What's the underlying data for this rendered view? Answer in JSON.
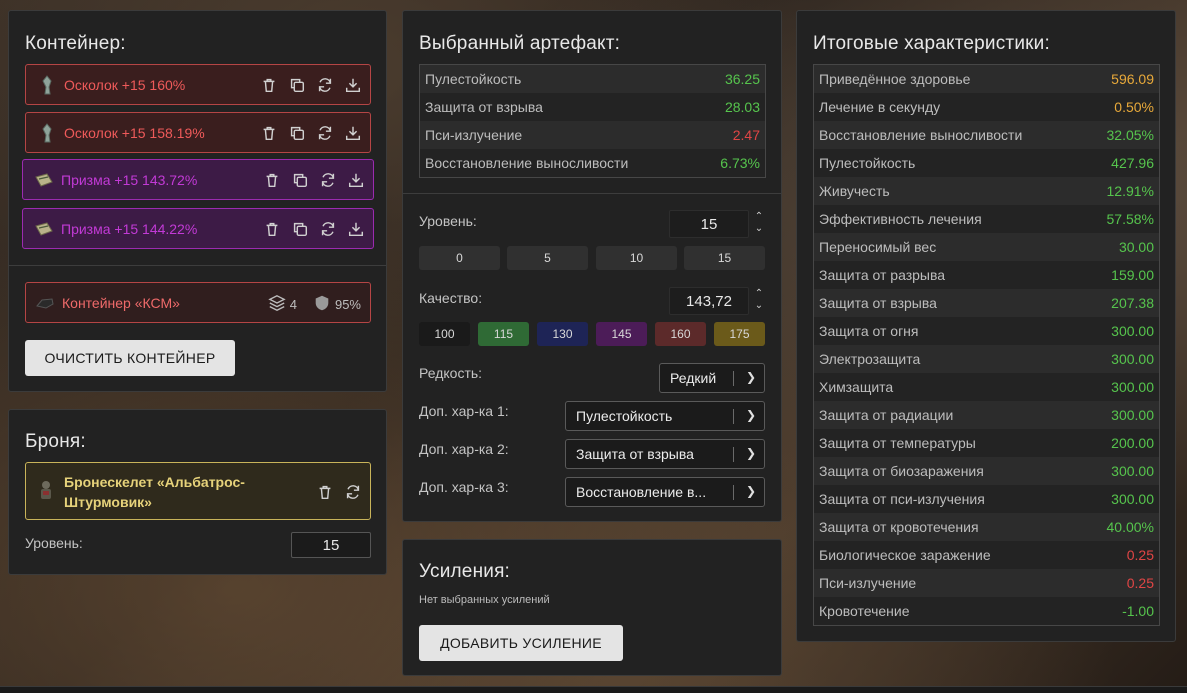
{
  "container": {
    "title": "Контейнер:",
    "artifacts": [
      {
        "name": "Осколок +15 160%",
        "rarity": "red",
        "icon": "shard-icon"
      },
      {
        "name": "Осколок +15 158.19%",
        "rarity": "red",
        "icon": "shard-icon"
      },
      {
        "name": "Призма +15 143.72%",
        "rarity": "purple",
        "icon": "prism-icon"
      },
      {
        "name": "Призма +15 144.22%",
        "rarity": "purple",
        "icon": "prism-icon"
      }
    ],
    "item": {
      "name": "Контейнер «КСМ»",
      "slots": "4",
      "protection": "95%"
    },
    "clear_button": "ОЧИСТИТЬ КОНТЕЙНЕР"
  },
  "armor": {
    "title": "Броня:",
    "item_line1": "Бронескелет «Альбатрос-",
    "item_line2": "Штурмовик»",
    "level_label": "Уровень:",
    "level_value": "15"
  },
  "selected": {
    "title": "Выбранный артефакт:",
    "stats": [
      {
        "label": "Пулестойкость",
        "value": "36.25",
        "color": "green"
      },
      {
        "label": "Защита от взрыва",
        "value": "28.03",
        "color": "green"
      },
      {
        "label": "Пси-излучение",
        "value": "2.47",
        "color": "red"
      },
      {
        "label": "Восстановление выносливости",
        "value": "6.73%",
        "color": "green"
      }
    ],
    "level_label": "Уровень:",
    "level_value": "15",
    "level_presets": [
      "0",
      "5",
      "10",
      "15"
    ],
    "quality_label": "Качество:",
    "quality_value": "143,72",
    "quality_presets": [
      {
        "label": "100",
        "color": "#1a1a1a"
      },
      {
        "label": "115",
        "color": "#2f6a35"
      },
      {
        "label": "130",
        "color": "#1e2456"
      },
      {
        "label": "145",
        "color": "#4c1c58"
      },
      {
        "label": "160",
        "color": "#5c2a2a"
      },
      {
        "label": "175",
        "color": "#6b5a1a"
      }
    ],
    "rarity_label": "Редкость:",
    "rarity_value": "Редкий",
    "extra1_label": "Доп. хар-ка 1:",
    "extra1_value": "Пулестойкость",
    "extra2_label": "Доп. хар-ка 2:",
    "extra2_value": "Защита от взрыва",
    "extra3_label": "Доп. хар-ка 3:",
    "extra3_value": "Восстановление в..."
  },
  "boosts": {
    "title": "Усиления:",
    "empty_text": "Нет выбранных усилений",
    "add_button": "ДОБАВИТЬ УСИЛЕНИЕ"
  },
  "totals": {
    "title": "Итоговые характеристики:",
    "stats": [
      {
        "label": "Приведённое здоровье",
        "value": "596.09",
        "color": "orange"
      },
      {
        "label": "Лечение в секунду",
        "value": "0.50%",
        "color": "orange"
      },
      {
        "label": "Восстановление выносливости",
        "value": "32.05%",
        "color": "green"
      },
      {
        "label": "Пулестойкость",
        "value": "427.96",
        "color": "green"
      },
      {
        "label": "Живучесть",
        "value": "12.91%",
        "color": "green"
      },
      {
        "label": "Эффективность лечения",
        "value": "57.58%",
        "color": "green"
      },
      {
        "label": "Переносимый вес",
        "value": "30.00",
        "color": "green"
      },
      {
        "label": "Защита от разрыва",
        "value": "159.00",
        "color": "green"
      },
      {
        "label": "Защита от взрыва",
        "value": "207.38",
        "color": "green"
      },
      {
        "label": "Защита от огня",
        "value": "300.00",
        "color": "green"
      },
      {
        "label": "Электрозащита",
        "value": "300.00",
        "color": "green"
      },
      {
        "label": "Химзащита",
        "value": "300.00",
        "color": "green"
      },
      {
        "label": "Защита от радиации",
        "value": "300.00",
        "color": "green"
      },
      {
        "label": "Защита от температуры",
        "value": "200.00",
        "color": "green"
      },
      {
        "label": "Защита от биозаражения",
        "value": "300.00",
        "color": "green"
      },
      {
        "label": "Защита от пси-излучения",
        "value": "300.00",
        "color": "green"
      },
      {
        "label": "Защита от кровотечения",
        "value": "40.00%",
        "color": "green"
      },
      {
        "label": "Биологическое заражение",
        "value": "0.25",
        "color": "red"
      },
      {
        "label": "Пси-излучение",
        "value": "0.25",
        "color": "red"
      },
      {
        "label": "Кровотечение",
        "value": "-1.00",
        "color": "green"
      }
    ]
  }
}
